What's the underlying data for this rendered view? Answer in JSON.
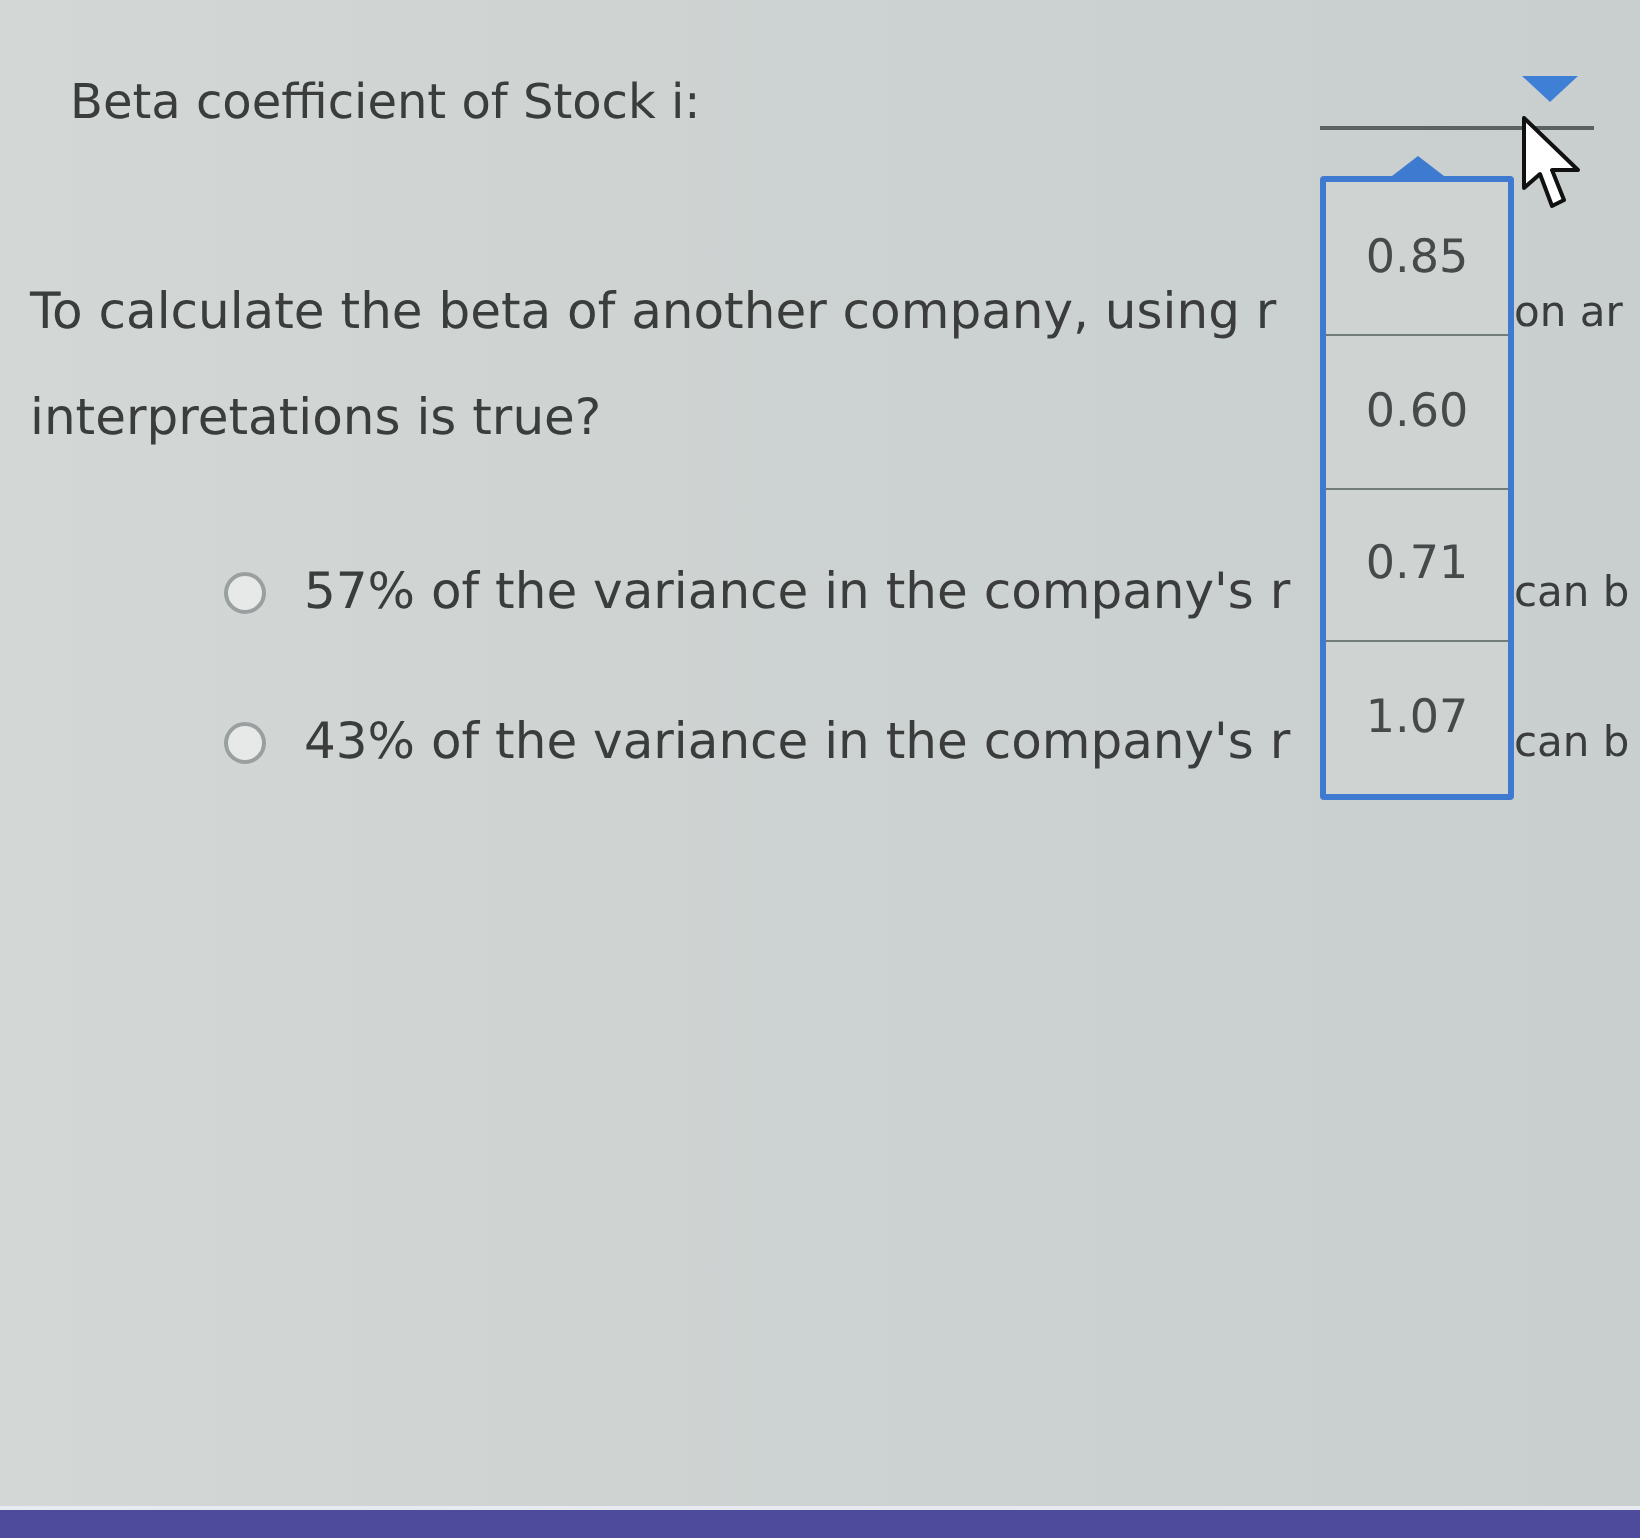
{
  "stock_field": {
    "label": "Beta coefficient of Stock i:",
    "expanded": true,
    "options": [
      {
        "label": "0.85",
        "selected": false
      },
      {
        "label": "0.60",
        "selected": false
      },
      {
        "label": "0.71",
        "selected": false
      },
      {
        "label": "1.07",
        "selected": false
      }
    ]
  },
  "question": {
    "lines": [
      {
        "text": "To calculate the beta of another company, using r",
        "text_after": "on ar"
      },
      {
        "text": "interpretations is true?"
      }
    ]
  },
  "choices": [
    {
      "text": "57% of the variance in the company's r",
      "text_after": "can b",
      "selected": false
    },
    {
      "text": "43% of the variance in the company's r",
      "text_after": "can b",
      "selected": false
    }
  ]
}
